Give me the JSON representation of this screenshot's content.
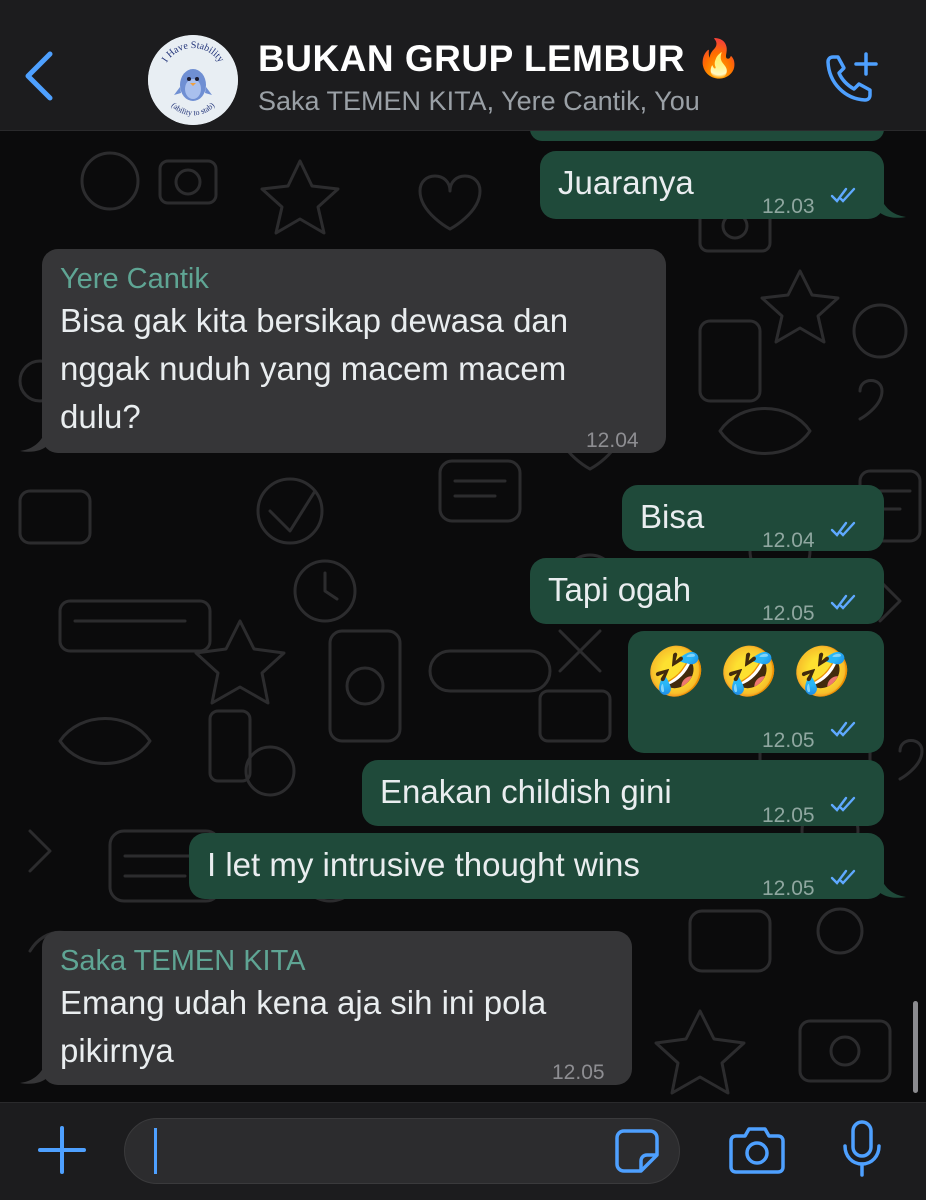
{
  "header": {
    "title": "BUKAN GRUP LEMBUR 🔥",
    "subtitle": "Saka TEMEN KITA, Yere Cantik, You",
    "avatar_text_top": "I Have Stability",
    "avatar_text_bottom": "(ability to stab)"
  },
  "messages": [
    {
      "direction": "out",
      "text": "Juaranya",
      "time": "12.03",
      "status": "read"
    },
    {
      "direction": "in",
      "sender": "Yere Cantik",
      "lines": [
        "Bisa gak kita bersikap dewasa dan",
        "nggak nuduh yang macem macem",
        "dulu?"
      ],
      "time": "12.04"
    },
    {
      "direction": "out",
      "text": "Bisa",
      "time": "12.04",
      "status": "read"
    },
    {
      "direction": "out",
      "text": "Tapi ogah",
      "time": "12.05",
      "status": "read"
    },
    {
      "direction": "out",
      "text": "🤣 🤣 🤣",
      "time": "12.05",
      "status": "read"
    },
    {
      "direction": "out",
      "text": "Enakan childish gini",
      "time": "12.05",
      "status": "read"
    },
    {
      "direction": "out",
      "text": "I let my intrusive thought wins",
      "time": "12.05",
      "status": "read"
    },
    {
      "direction": "in",
      "sender": "Saka TEMEN KITA",
      "lines": [
        "Emang udah kena aja sih ini pola",
        "pikirnya"
      ],
      "time": "12.05"
    }
  ],
  "composer": {
    "placeholder": ""
  },
  "colors": {
    "outgoing_bubble": "#1f4a3a",
    "incoming_bubble": "#363638",
    "sender_name": "#5fa594",
    "accent": "#4ea0ff"
  },
  "icons": {
    "back": "chevron-left-icon",
    "call": "add-call-icon",
    "attach": "plus-icon",
    "sticker": "sticker-icon",
    "camera": "camera-icon",
    "mic": "microphone-icon",
    "read": "double-check-icon"
  }
}
